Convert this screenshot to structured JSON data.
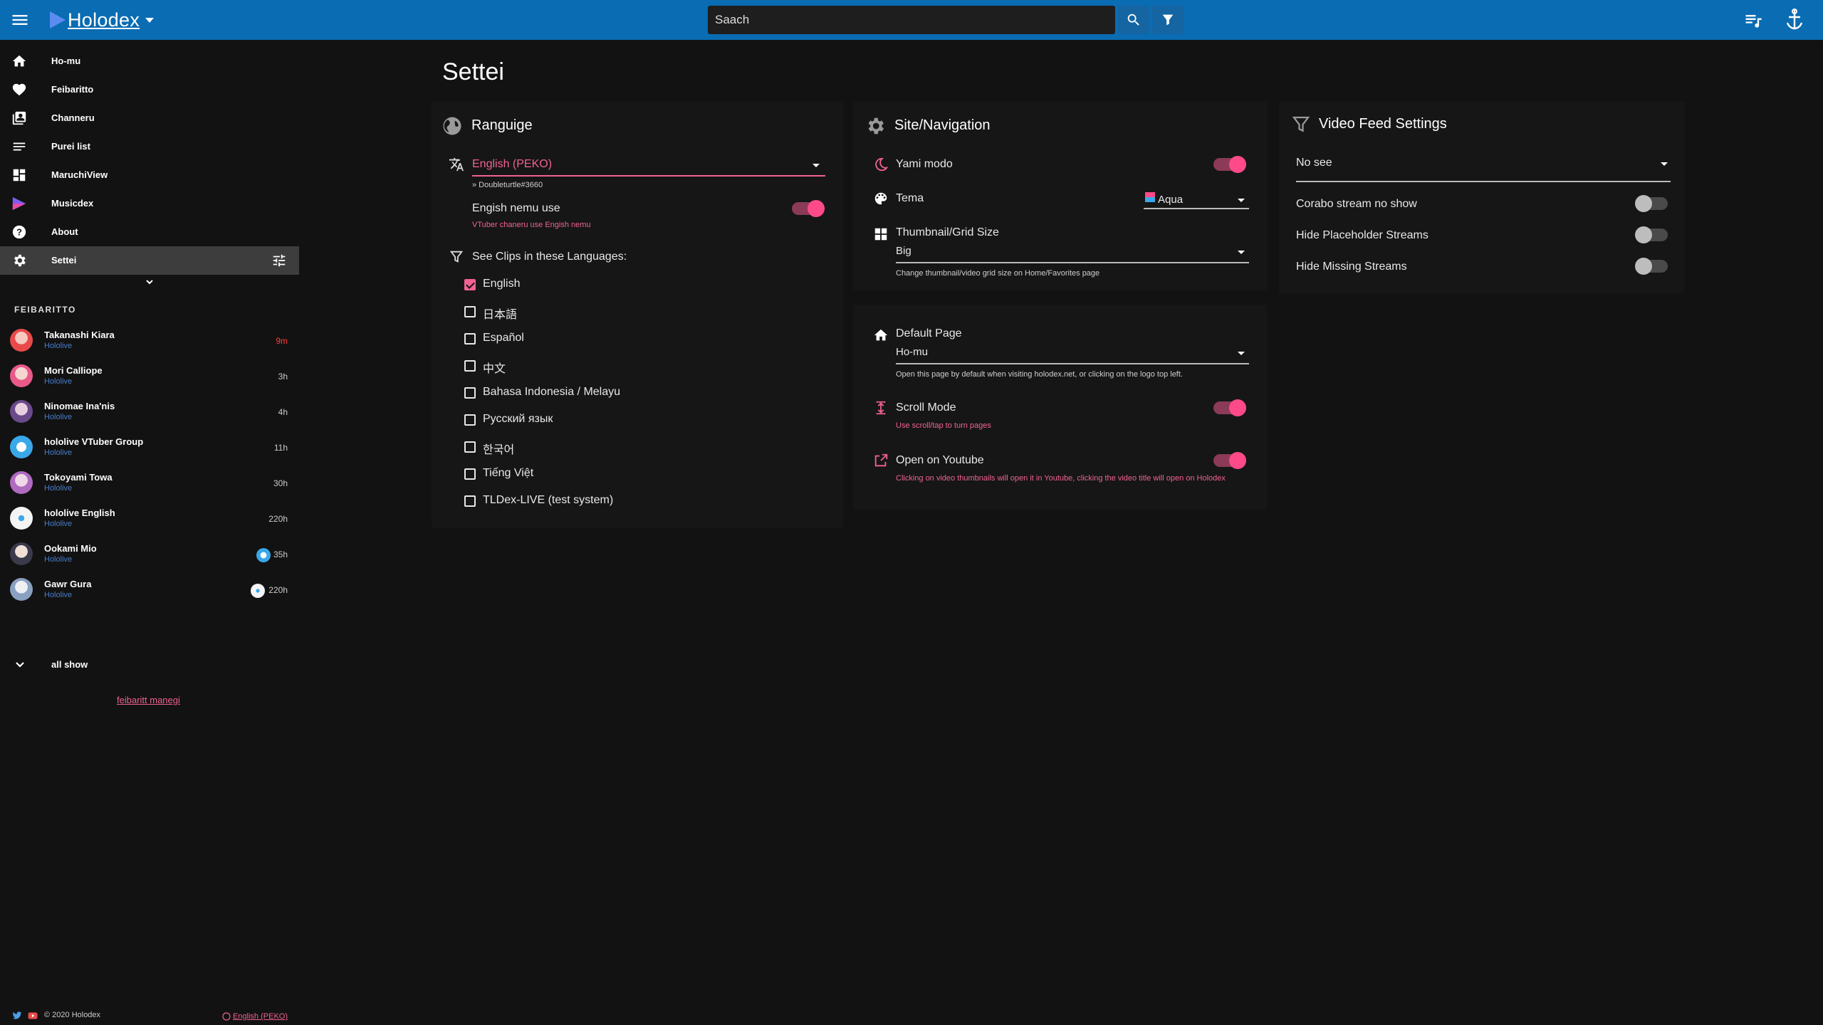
{
  "topbar": {
    "brand": "Holodex",
    "search_placeholder": "Saach"
  },
  "sidebar": {
    "nav": [
      {
        "label": "Ho-mu",
        "icon": "home-icon"
      },
      {
        "label": "Feibaritto",
        "icon": "heart-icon"
      },
      {
        "label": "Channeru",
        "icon": "channels-icon"
      },
      {
        "label": "Purei list",
        "icon": "playlist-icon"
      },
      {
        "label": "MaruchiView",
        "icon": "grid-icon"
      },
      {
        "label": "Musicdex",
        "icon": "musicdex-icon"
      },
      {
        "label": "About",
        "icon": "help-icon"
      },
      {
        "label": "Settei",
        "icon": "gear-icon",
        "active": true
      }
    ],
    "favorites_header": "FEIBARITTO",
    "favorites": [
      {
        "name": "Takanashi Kiara",
        "org": "Hololive",
        "time": "9m",
        "live": true
      },
      {
        "name": "Mori Calliope",
        "org": "Hololive",
        "time": "3h"
      },
      {
        "name": "Ninomae Ina'nis",
        "org": "Hololive",
        "time": "4h"
      },
      {
        "name": "hololive VTuber Group",
        "org": "Hololive",
        "time": "11h"
      },
      {
        "name": "Tokoyami Towa",
        "org": "Hololive",
        "time": "30h"
      },
      {
        "name": "hololive English",
        "org": "Hololive",
        "time": "220h"
      },
      {
        "name": "Ookami Mio",
        "org": "Hololive",
        "time": "35h"
      },
      {
        "name": "Gawr Gura",
        "org": "Hololive",
        "time": "220h"
      }
    ],
    "all_show": "all show",
    "manage_link": "feibaritt manegi",
    "footer": {
      "copyright": "© 2020 Holodex",
      "language": "English (PEKO)"
    }
  },
  "main": {
    "title": "Settei",
    "language_card": {
      "title": "Ranguige",
      "selected_language": "English (PEKO)",
      "translator": "» Doubleturtle#3660",
      "english_names_label": "Engish nemu use",
      "english_names_hint": "VTuber chaneru use Engish nemu",
      "clips_title": "See Clips in these Languages:",
      "clip_languages": [
        {
          "label": "English",
          "checked": true
        },
        {
          "label": "日本語",
          "checked": false
        },
        {
          "label": "Español",
          "checked": false
        },
        {
          "label": "中文",
          "checked": false
        },
        {
          "label": "Bahasa Indonesia / Melayu",
          "checked": false
        },
        {
          "label": "Русский язык",
          "checked": false
        },
        {
          "label": "한국어",
          "checked": false
        },
        {
          "label": "Tiếng Việt",
          "checked": false
        },
        {
          "label": "TLDex-LIVE (test system)",
          "checked": false
        }
      ]
    },
    "site_card": {
      "title": "Site/Navigation",
      "dark_mode_label": "Yami modo",
      "theme_label": "Tema",
      "theme_value": "Aqua",
      "grid_size_label": "Thumbnail/Grid Size",
      "grid_size_value": "Big",
      "grid_size_hint": "Change thumbnail/video grid size on Home/Favorites page"
    },
    "default_card": {
      "default_page_label": "Default Page",
      "default_page_value": "Ho-mu",
      "default_page_hint": "Open this page by default when visiting holodex.net, or clicking on the logo top left.",
      "scroll_mode_label": "Scroll Mode",
      "scroll_mode_hint": "Use scroll/tap to turn pages",
      "open_youtube_label": "Open on Youtube",
      "open_youtube_hint": "Clicking on video thumbnails will open it in Youtube, clicking the video title will open on Holodex"
    },
    "feed_card": {
      "title": "Video Feed Settings",
      "hidden_select": "No see",
      "collab_label": "Corabo stream no show",
      "placeholder_label": "Hide Placeholder Streams",
      "missing_label": "Hide Missing Streams"
    }
  },
  "colors": {
    "topbar": "#0a6cb3",
    "accent": "#f06292",
    "toggle_on": "#ff4a8a",
    "background": "#121212",
    "card": "#161616"
  }
}
